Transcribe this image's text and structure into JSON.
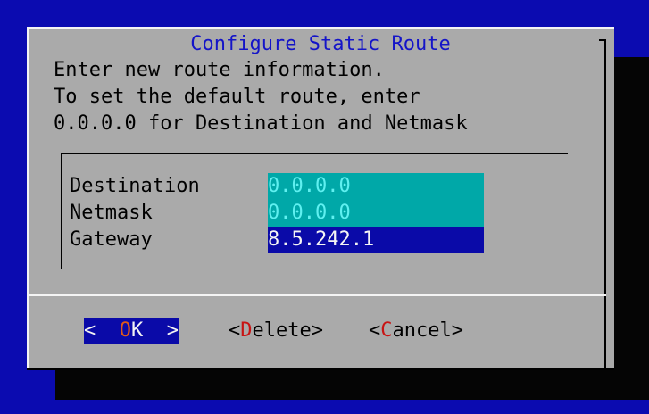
{
  "dialog": {
    "title": "Configure Static Route",
    "message_lines": [
      "Enter new route information.",
      "To set the default route, enter",
      "0.0.0.0 for Destination and Netmask"
    ]
  },
  "fields": [
    {
      "label": "Destination",
      "value": "0.0.0.0"
    },
    {
      "label": "Netmask",
      "value": "0.0.0.0"
    },
    {
      "label": "Gateway",
      "value": "8.5.242.1"
    }
  ],
  "buttons": {
    "ok": {
      "prefix": "<  ",
      "hotkey": "O",
      "rest": "K",
      "suffix": "  >"
    },
    "delete": {
      "prefix": "<",
      "hotkey": "D",
      "rest": "elete",
      "suffix": ">"
    },
    "cancel": {
      "prefix": "<",
      "hotkey": "C",
      "rest": "ancel",
      "suffix": ">"
    }
  },
  "colors": {
    "background": "#0b0bb0",
    "dialog": "#aaaaaa",
    "title": "#1414c8",
    "inactive_field": "#00a8a8",
    "active_field": "#0a0aa8",
    "hotkey": "#c81414"
  }
}
